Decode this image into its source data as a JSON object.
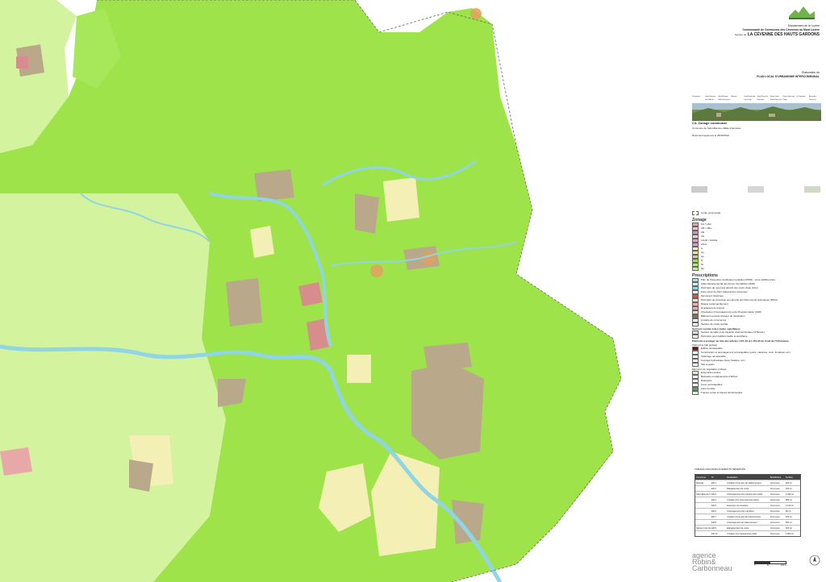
{
  "header": {
    "department": "Département de la Lozère",
    "community": "Communauté de Communes des Cévennes au Mont Lozère",
    "sector_prefix": "Secteur de",
    "sector": "LA CÉVENNE DES HAUTS GARDONS",
    "plan_prefix": "Élaboration du",
    "plan": "PLAN LOCAL D'URBANISME INTERCOMMUNAL"
  },
  "photo_labels": [
    "Cassagnas",
    "Saint-Germain-de-Calberte",
    "Saint-Étienne-Vallée-Française",
    "Moissac",
    "Saint-Martin-de-Lansuscle",
    "Saint-Privat-de-Vallongue",
    "Sainte-Croix-Vallée-Française",
    "Saint-Julien-des-Points",
    "Le Pompidou",
    "Barre-des-Cévennes"
  ],
  "document": {
    "title": "C4. Zonage communal",
    "commune": "Commune de Saint-Étienne-Vallée-Française",
    "date": "Document approuvé le 25/02/2021"
  },
  "legend": {
    "commune_limit": "Limite communale",
    "zonage_title": "Zonage",
    "zones": [
      {
        "label": "UA / UAm",
        "color": "#e7a3a3"
      },
      {
        "label": "UB / UBm",
        "color": "#f0c4c4"
      },
      {
        "label": "UE",
        "color": "#d98cc4"
      },
      {
        "label": "UH",
        "color": "#f4d0d8"
      },
      {
        "label": "1AUD / 1AUDa",
        "color": "#e9a0b8"
      },
      {
        "label": "2AUL",
        "color": "#d0a0d0"
      },
      {
        "label": "A",
        "color": "#f7f3b6"
      },
      {
        "label": "Ap",
        "color": "#efe7a0"
      },
      {
        "label": "Ae",
        "color": "#d9c99a"
      },
      {
        "label": "N",
        "color": "#9ee34a"
      },
      {
        "label": "Nl",
        "color": "#b6eb6c"
      },
      {
        "label": "Np",
        "color": "#c8f090"
      }
    ],
    "prescriptions_title": "Prescriptions",
    "prescriptions": [
      "Plan de Prévention du Risque Inondation (PPRi) - zone indifférenciée",
      "Atlas Départemental des Zones Inondables (ADZI)",
      "Périmètre de recul aux abords des cours d'eau (10m)",
      "Zone cœur du Parc National des Cévennes",
      "Monument historique",
      "Périmètre de protection aux abords des Monuments Historiques (500m)",
      "Risque retrait-gonflement",
      "Emplacement réservé",
      "Orientation d'Aménagement et de Programmation (OAP)",
      "Bâtiment pouvant changer de destination",
      "Linéaire de commerces",
      "Secteur de mixité sociale"
    ],
    "secteurs_title": "Secteurs soumis à des règles spécifiques",
    "secteurs": [
      "Secteur de taille et de capacité d'accueil limitées (STECAL)",
      "Périmètre pour habitat insolite et spécifique"
    ],
    "elements_title": "Éléments à protéger au titre des articles L151-19 et L151-23 du Code de l'Urbanisme",
    "patrimoine_title": "Patrimoine bâti protégé",
    "patrimoine": [
      "Édifice remarquable",
      "Construction et aménagement remarquables (ponts, calvaires, croix, fontaines, etc.)",
      "Clôturage remarquable",
      "Ouvrage hydraulique (béal, béalière, etc.)",
      "Site et jardin"
    ],
    "vegetal_title": "Éléments de végétation protégé",
    "vegetal": [
      "Ensembles boisés",
      "Bosquets ou alignements d'arbres",
      "Ripisylves",
      "Lieux remarquables",
      "Zone humide",
      "Trames vertes et bleues fonctionnelles"
    ]
  },
  "table": {
    "title": "TABLEAU DES EMPLACEMENTS RÉSERVÉS",
    "headers": [
      "Commune",
      "N°",
      "Destination",
      "Bénéficiaire",
      "Surface"
    ],
    "rows": [
      [
        "Moissac",
        "ER 1",
        "Création d'une aire de stationnement",
        "Commune",
        "320 m²"
      ],
      [
        "",
        "ER 2",
        "Élargissement de voirie",
        "Commune",
        "150 m²"
      ],
      [
        "Saint-Étienne-Vallée-Française",
        "ER 3",
        "Aménagement d'un équipement public",
        "Commune",
        "1 250 m²"
      ],
      [
        "",
        "ER 4",
        "Création d'un cheminement piéton",
        "Commune",
        "480 m²"
      ],
      [
        "",
        "ER 5",
        "Extension du cimetière",
        "Commune",
        "2 100 m²"
      ],
      [
        "",
        "ER 6",
        "Aménagement d'un carrefour",
        "Commune",
        "90 m²"
      ],
      [
        "",
        "ER 7",
        "Création d'une aire de retournement",
        "Commune",
        "220 m²"
      ],
      [
        "",
        "ER 8",
        "Aménagement de stationnement",
        "Commune",
        "600 m²"
      ],
      [
        "Sainte-Croix-Vallée-Française",
        "ER 9",
        "Élargissement de voirie",
        "Commune",
        "310 m²"
      ],
      [
        "",
        "ER 10",
        "Création d'un équipement public",
        "Commune",
        "1 800 m²"
      ]
    ]
  },
  "brand": {
    "name1": "agence",
    "name2": "Robin&",
    "name3": "Carbonneau"
  },
  "scale": {
    "labels": [
      "0",
      "50",
      "100 m"
    ]
  },
  "colors": {
    "zone_n": "#9ee34a",
    "zone_np": "#c8f090",
    "zone_a": "#f7f3b6",
    "zone_ae": "#b9a98a",
    "river": "#8fd5e3",
    "urban": "#d88d8d"
  }
}
